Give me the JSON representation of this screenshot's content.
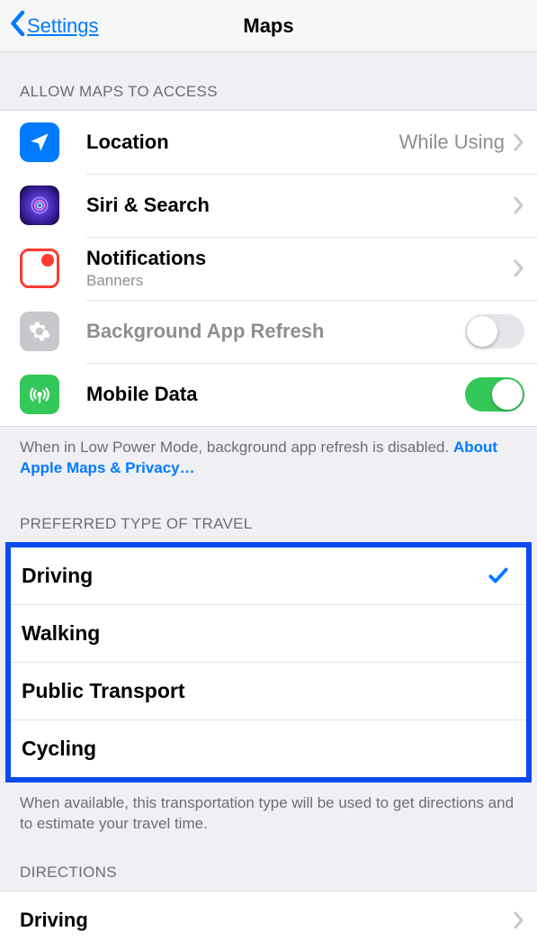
{
  "navbar": {
    "back_label": "Settings",
    "title": "Maps"
  },
  "sections": {
    "access_header": "ALLOW MAPS TO ACCESS",
    "travel_header": "PREFERRED TYPE OF TRAVEL",
    "directions_header": "DIRECTIONS"
  },
  "access_rows": {
    "location": {
      "title": "Location",
      "detail": "While Using"
    },
    "siri": {
      "title": "Siri & Search"
    },
    "notif": {
      "title": "Notifications",
      "subtitle": "Banners"
    },
    "refresh": {
      "title": "Background App Refresh",
      "on": false
    },
    "mobile": {
      "title": "Mobile Data",
      "on": true
    }
  },
  "access_footer": {
    "text": "When in Low Power Mode, background app refresh is disabled. ",
    "link": "About Apple Maps & Privacy…"
  },
  "travel_types": [
    {
      "label": "Driving",
      "selected": true
    },
    {
      "label": "Walking",
      "selected": false
    },
    {
      "label": "Public Transport",
      "selected": false
    },
    {
      "label": "Cycling",
      "selected": false
    }
  ],
  "travel_footer": "When available, this transportation type will be used to get directions and to estimate your travel time.",
  "directions_rows": [
    {
      "label": "Driving"
    }
  ]
}
